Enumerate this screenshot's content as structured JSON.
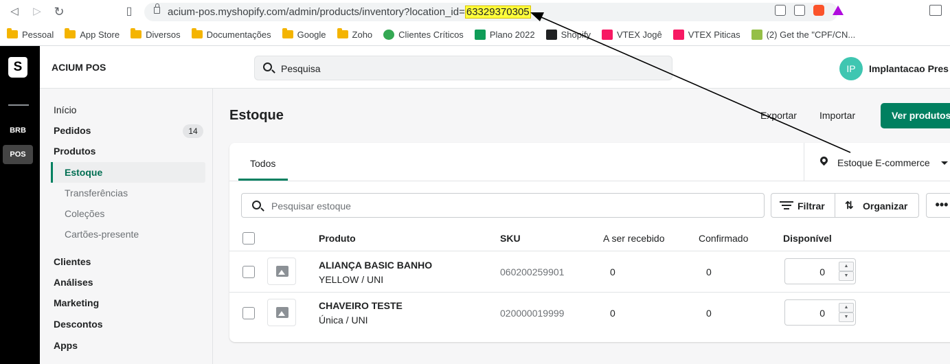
{
  "browser": {
    "url_prefix": "acium-pos.myshopify.com/admin/products/inventory?location_id=",
    "url_highlight": "63329370305",
    "bookmarks": [
      "Pessoal",
      "App Store",
      "Diversos",
      "Documentações",
      "Google",
      "Zoho",
      "Clientes Críticos",
      "Plano 2022",
      "Shopify",
      "VTEX Jogê",
      "VTEX Piticas",
      "(2) Get the \"CPF/CN..."
    ]
  },
  "rail": {
    "logo": "S",
    "items": [
      "BRB",
      "POS"
    ]
  },
  "header": {
    "store_name": "ACIUM POS",
    "search_placeholder": "Pesquisa",
    "avatar_initials": "IP",
    "user_name": "Implantacao Pres"
  },
  "sidebar": {
    "items": [
      "Início",
      "Pedidos",
      "Produtos"
    ],
    "orders_count": "14",
    "product_subitems": [
      "Estoque",
      "Transferências",
      "Coleções",
      "Cartões-presente"
    ],
    "items2": [
      "Clientes",
      "Análises",
      "Marketing",
      "Descontos",
      "Apps"
    ]
  },
  "page": {
    "title": "Estoque",
    "export": "Exportar",
    "import": "Importar",
    "view_products": "Ver produtos"
  },
  "inventory": {
    "tab": "Todos",
    "location": "Estoque E-commerce",
    "search_placeholder": "Pesquisar estoque",
    "filter": "Filtrar",
    "sort": "Organizar",
    "more": "•••",
    "headers": [
      "Produto",
      "SKU",
      "A ser recebido",
      "Confirmado",
      "Disponível"
    ],
    "rows": [
      {
        "name": "ALIANÇA BASIC BANHO",
        "variant": "YELLOW / UNI",
        "sku": "060200259901",
        "incoming": "0",
        "committed": "0",
        "available": "0"
      },
      {
        "name": "CHAVEIRO TESTE",
        "variant": "Única / UNI",
        "sku": "020000019999",
        "incoming": "0",
        "committed": "0",
        "available": "0"
      }
    ]
  }
}
